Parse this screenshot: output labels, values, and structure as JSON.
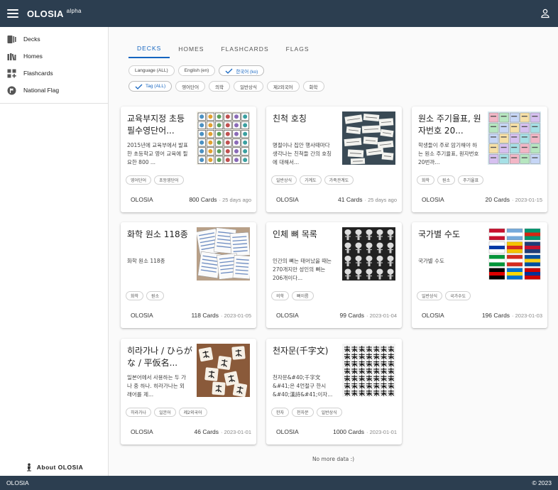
{
  "app": {
    "title": "OLOSIA",
    "badge": "alpha"
  },
  "sidebar": {
    "items": [
      {
        "label": "Decks",
        "icon": "decks-icon"
      },
      {
        "label": "Homes",
        "icon": "homes-icon"
      },
      {
        "label": "Flashcards",
        "icon": "flashcards-icon"
      },
      {
        "label": "National Flag",
        "icon": "flag-icon"
      }
    ],
    "about": "About OLOSIA"
  },
  "tabs": [
    "DECKS",
    "HOMES",
    "FLASHCARDS",
    "FLAGS"
  ],
  "filters": {
    "languages": [
      {
        "label": "Language (ALL)",
        "selected": false
      },
      {
        "label": "English (en)",
        "selected": false
      },
      {
        "label": "한국어 (ko)",
        "selected": true
      }
    ],
    "tags": [
      {
        "label": "Tag (ALL)",
        "selected": true
      },
      {
        "label": "영어단어",
        "selected": false
      },
      {
        "label": "의학",
        "selected": false
      },
      {
        "label": "일반상식",
        "selected": false
      },
      {
        "label": "제2외국어",
        "selected": false
      },
      {
        "label": "화학",
        "selected": false
      }
    ]
  },
  "decks": [
    {
      "title": "교육부지정 초등필수영단어...",
      "description": "2015년에 교육부에서 발표한 초등학교 영어 교육에 필요한 800 ...",
      "tags": [
        "영어단어",
        "초등영단어"
      ],
      "owner": "OLOSIA",
      "cards": "800 Cards",
      "date": "· 25 days ago",
      "thumb": "icons"
    },
    {
      "title": "친척 호칭",
      "description": "명절이나 집안 행사때마다 생각나는 친척들 간의 호칭에 대해서...",
      "tags": [
        "일반상식",
        "가계도",
        "가족관계도"
      ],
      "owner": "OLOSIA",
      "cards": "41 Cards",
      "date": "· 25 days ago",
      "thumb": "papers"
    },
    {
      "title": "원소 주기율표, 원자번호 20...",
      "description": "학생들이 주로 암기해야 하는 원소 주기율표, 원자번호 20번까...",
      "tags": [
        "화학",
        "원소",
        "주기율표"
      ],
      "owner": "OLOSIA",
      "cards": "20 Cards",
      "date": "· 2023-01-15",
      "thumb": "periodic"
    },
    {
      "title": "화학 원소 118종",
      "description": "화학 원소 118종",
      "tags": [
        "화학",
        "원소"
      ],
      "owner": "OLOSIA",
      "cards": "118 Cards",
      "date": "· 2023-01-05",
      "thumb": "cards"
    },
    {
      "title": "인체 뼈 목록",
      "description": "인간의 뼈는 태어났을 때는 270개지만 성인의 뼈는 206개이다...",
      "tags": [
        "의학",
        "뼈이름"
      ],
      "owner": "OLOSIA",
      "cards": "99 Cards",
      "date": "· 2023-01-04",
      "thumb": "bones"
    },
    {
      "title": "국가별 수도",
      "description": "국가별 수도",
      "tags": [
        "일반상식",
        "국가수도"
      ],
      "owner": "OLOSIA",
      "cards": "196 Cards",
      "date": "· 2023-01-03",
      "thumb": "flags"
    },
    {
      "title": "히라가나 / ひらがな / 平仮名...",
      "description": "일본어에서 사용하는 두 가나 중 하나. 히라가나는 외래어를 제...",
      "tags": [
        "히라가나",
        "일본어",
        "제2외국어"
      ],
      "owner": "OLOSIA",
      "cards": "46 Cards",
      "date": "· 2023-01-01",
      "thumb": "kana"
    },
    {
      "title": "천자문(千字文)",
      "description": "천자문&#40;千字文&#41;은 4언절구 한시&#40;漢詩&#41;이자...",
      "tags": [
        "한자",
        "천자문",
        "일반상식"
      ],
      "owner": "OLOSIA",
      "cards": "1000 Cards",
      "date": "· 2023-01-01",
      "thumb": "hanja"
    }
  ],
  "nomore": "No more data :)",
  "footer": {
    "brand": "OLOSIA",
    "copyright": "© 2023"
  },
  "colors": {
    "appbar": "#2c3e50",
    "accent": "#1565c0"
  }
}
